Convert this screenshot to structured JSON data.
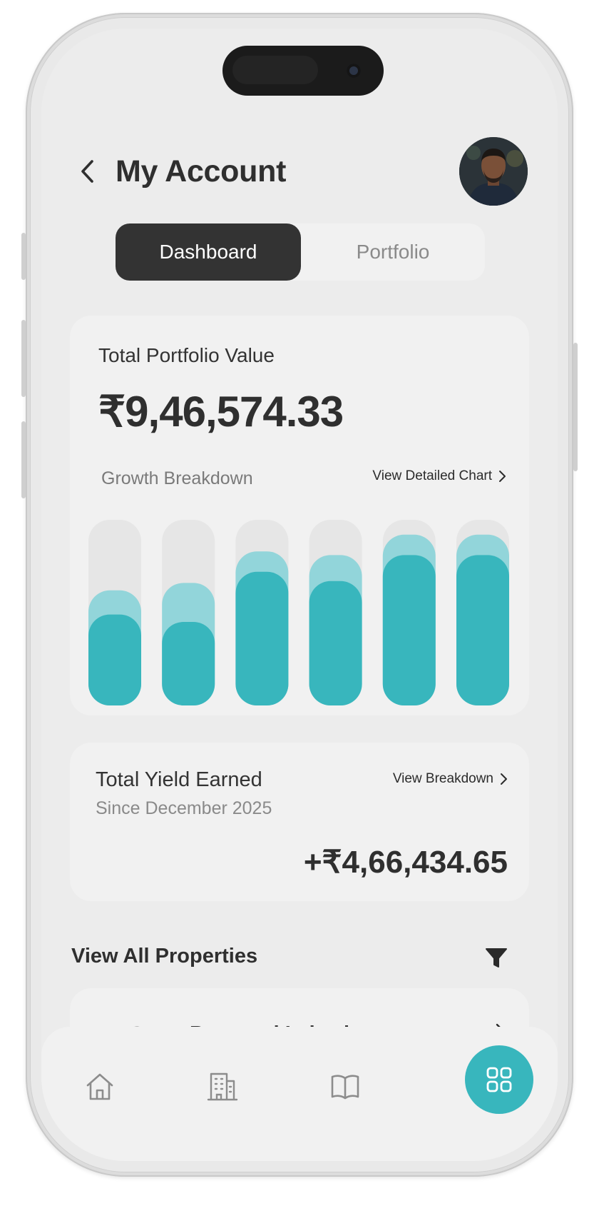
{
  "header": {
    "title": "My Account"
  },
  "tabs": [
    {
      "label": "Dashboard",
      "active": true
    },
    {
      "label": "Portfolio",
      "active": false
    }
  ],
  "portfolio": {
    "label": "Total Portfolio Value",
    "value": "₹9,46,574.33",
    "growth_label": "Growth Breakdown",
    "detail_link": "View Detailed Chart"
  },
  "chart_data": {
    "type": "bar",
    "categories": [
      "",
      "",
      "",
      "",
      "",
      ""
    ],
    "series": [
      {
        "values": [
          49,
          45,
          72,
          67,
          81,
          81
        ]
      },
      {
        "values": [
          62,
          66,
          83,
          81,
          92,
          92
        ]
      }
    ],
    "ylim": [
      0,
      100
    ],
    "colors": {
      "primary": "#38b6bd",
      "secondary": "#92d5da",
      "track": "#e6e6e6"
    }
  },
  "yield": {
    "title": "Total Yield Earned",
    "since": "Since December 2025",
    "link": "View Breakdown",
    "value": "+₹4,66,434.65"
  },
  "properties": {
    "title": "View All Properties",
    "items": [
      {
        "name": "Pepproni Lakeview"
      }
    ]
  },
  "nav": {
    "items": [
      "home-icon",
      "building-icon",
      "book-icon",
      "grid-icon"
    ],
    "active": "grid-icon"
  },
  "colors": {
    "accent": "#38b6bd",
    "dark": "#333333",
    "background": "#ececec",
    "card": "#f1f1f1"
  }
}
